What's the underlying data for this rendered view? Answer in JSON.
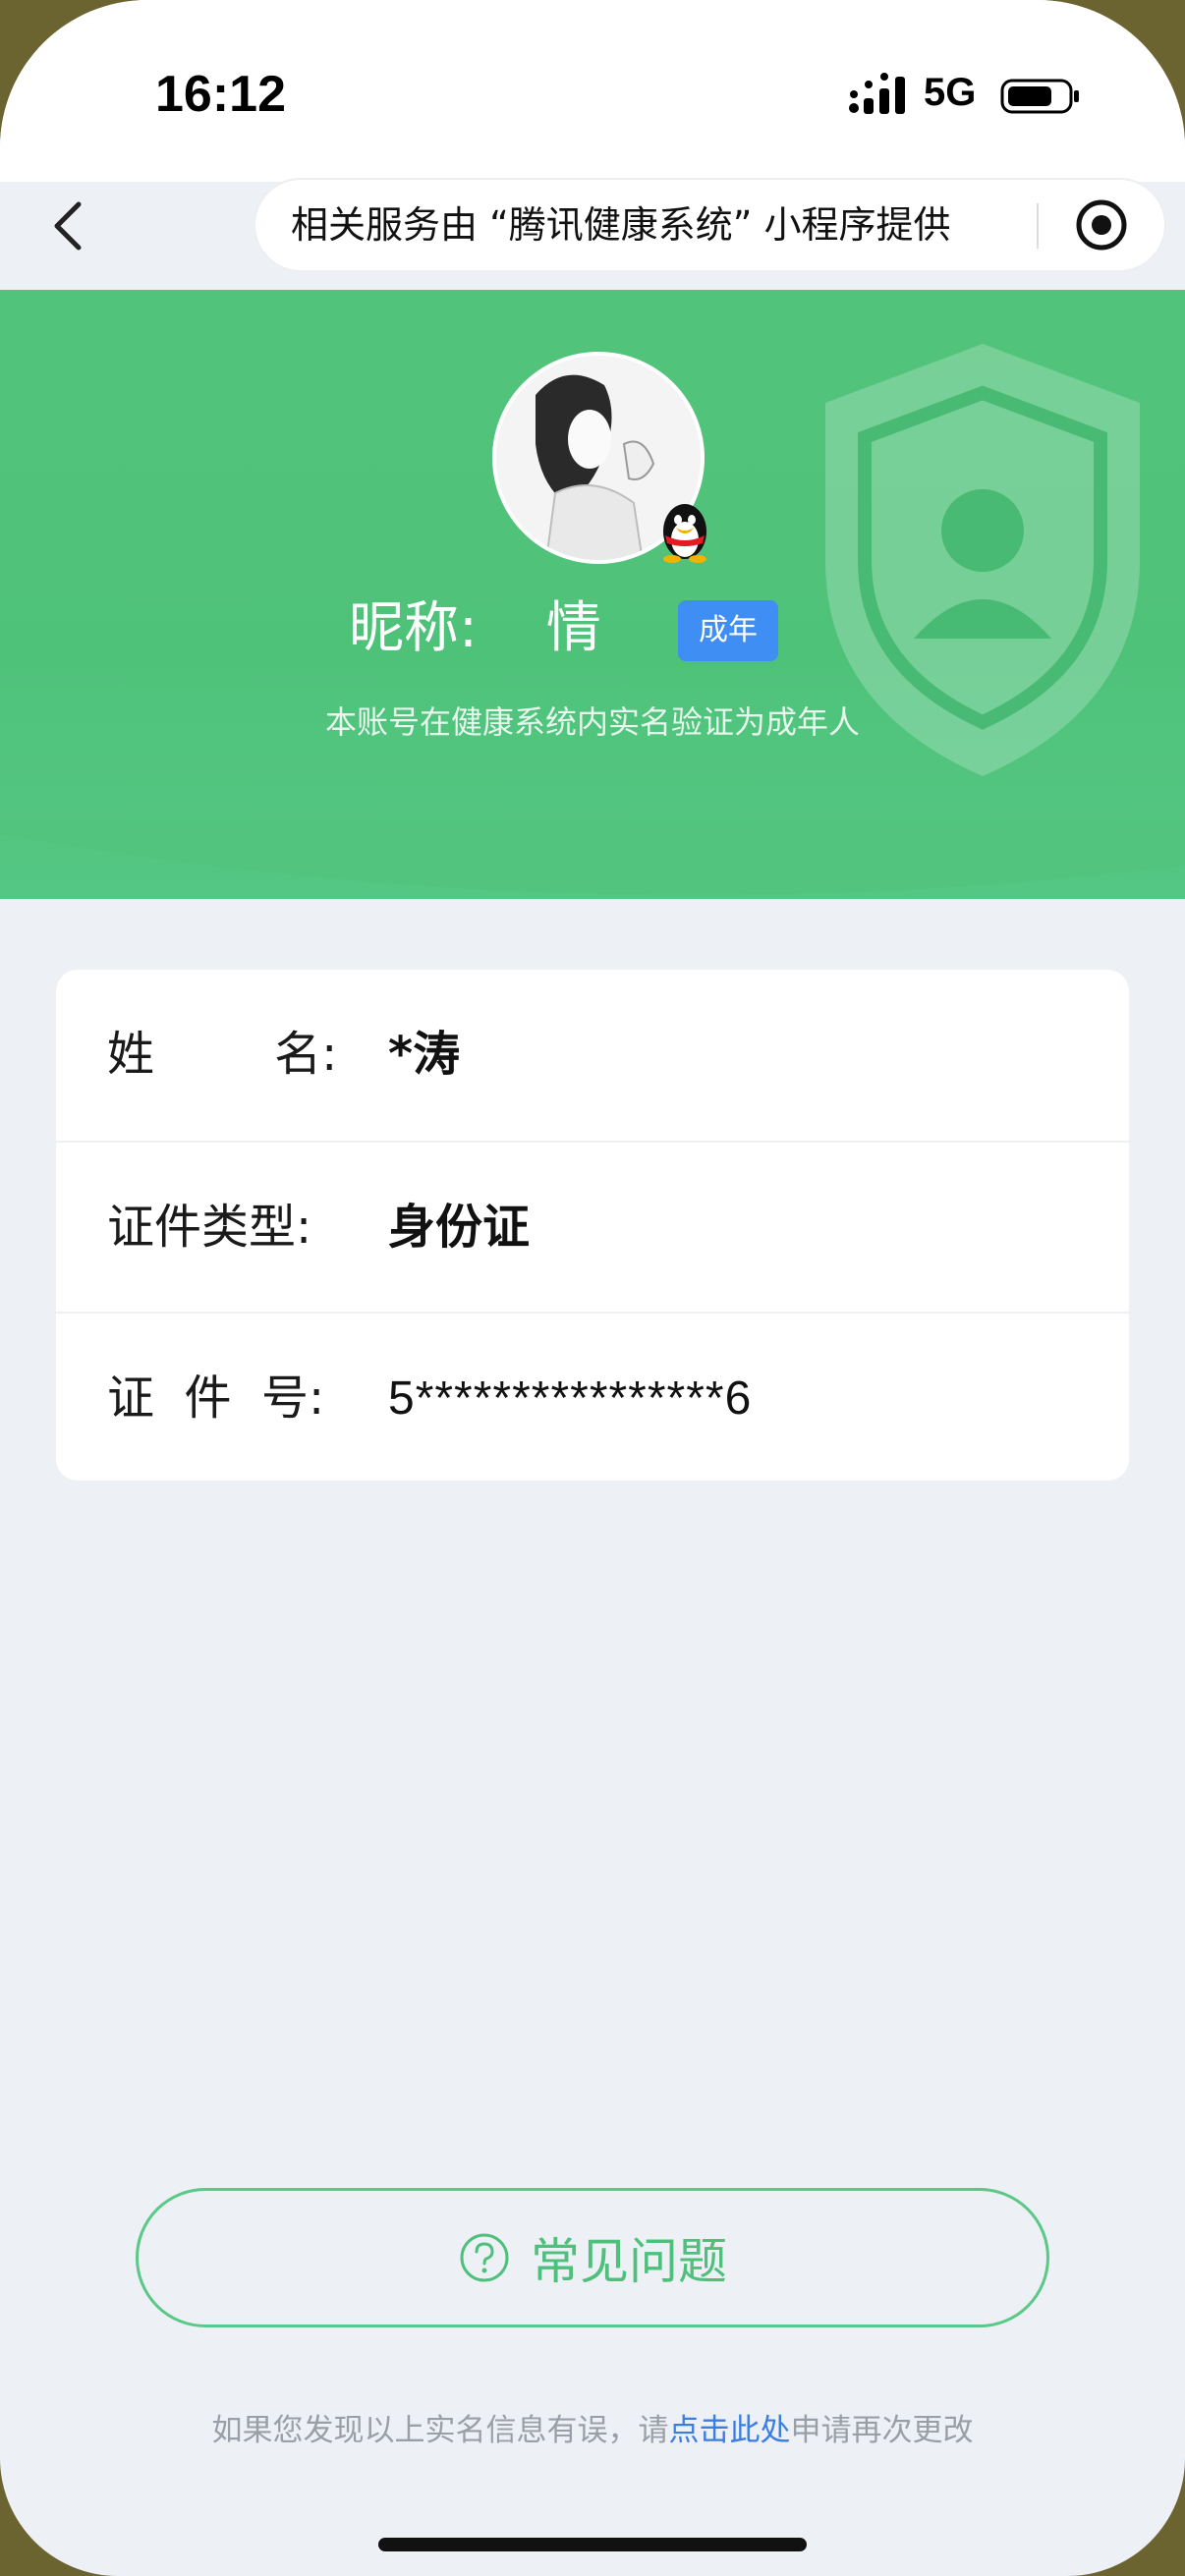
{
  "status_bar": {
    "time": "16:12",
    "network": "5G"
  },
  "nav": {
    "capsule_text": "相关服务由 “腾讯健康系统” 小程序提供"
  },
  "profile": {
    "nickname_label": "昵称:",
    "nickname_value": "情",
    "age_badge": "成年",
    "subtitle": "本账号在健康系统内实名验证为成年人"
  },
  "info": {
    "rows": [
      {
        "label": "姓        名:",
        "value": "*涛"
      },
      {
        "label": "证件类型:",
        "value": "身份证"
      },
      {
        "label": "证  件  号:",
        "value": "5****************6"
      }
    ]
  },
  "faq": {
    "label": "常见问题"
  },
  "footer": {
    "prefix": "如果您发现以上实名信息有误，请",
    "link": "点击此处",
    "suffix": "申请再次更改"
  },
  "colors": {
    "header_green": "#4fc27a",
    "badge_blue": "#3f8ef3",
    "link_blue": "#3c7ee0",
    "faq_green": "#4fbf7c"
  },
  "icons": [
    "back-icon",
    "target-icon",
    "signal-icon",
    "battery-icon",
    "qq-penguin-icon",
    "shield-icon",
    "question-icon"
  ]
}
